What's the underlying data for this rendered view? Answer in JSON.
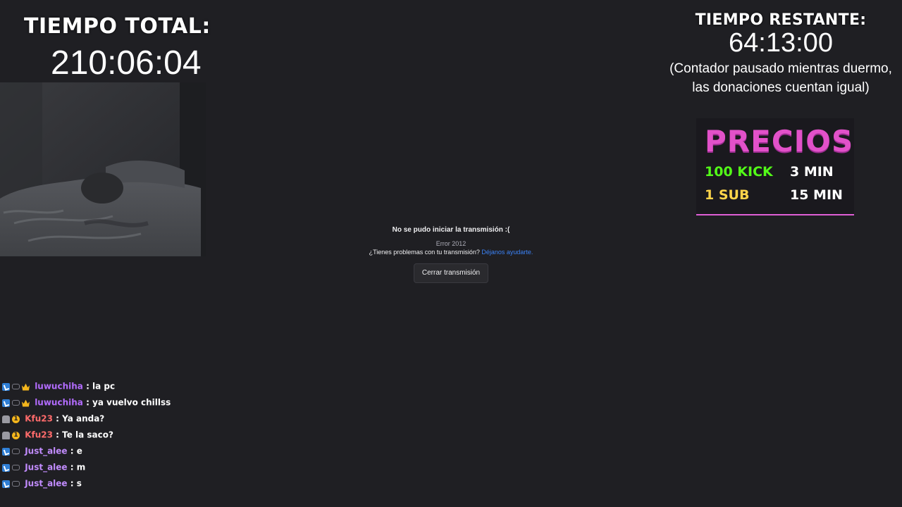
{
  "overlay": {
    "total_title": "TIEMPO TOTAL:",
    "total_time": "210:06:04",
    "remaining_title": "TIEMPO RESTANTE:",
    "remaining_time": "64:13:00",
    "remaining_note_line1": "(Contador pausado mientras duermo,",
    "remaining_note_line2": "las donaciones cuentan igual)"
  },
  "prices": {
    "title": "PRECIOS",
    "rows": [
      {
        "amount": "100 KICK",
        "time": "3 MIN",
        "color": "#53fc18"
      },
      {
        "amount": "1 SUB",
        "time": "15 MIN",
        "color": "#ffd54a"
      }
    ],
    "title_color": "#e251c9"
  },
  "error": {
    "title": "No se pudo iniciar la transmisión :(",
    "code": "Error 2012",
    "help_text": "¿Tienes problemas con tu transmisión?",
    "help_link": "Déjanos ayudarte.",
    "close_button": "Cerrar transmisión"
  },
  "chat": {
    "messages": [
      {
        "user": "luwuchiha",
        "text": "la pc",
        "user_color": "#b36cff",
        "badges": [
          "prime-icon",
          "link-icon",
          "crown-icon"
        ]
      },
      {
        "user": "luwuchiha",
        "text": "ya vuelvo chillss",
        "user_color": "#b36cff",
        "badges": [
          "prime-icon",
          "link-icon",
          "crown-icon"
        ]
      },
      {
        "user": "Kfu23",
        "text": "Ya anda?",
        "user_color": "#ff6b6b",
        "badges": [
          "bot-icon",
          "one-month-icon"
        ]
      },
      {
        "user": "Kfu23",
        "text": "Te la saco?",
        "user_color": "#ff6b6b",
        "badges": [
          "bot-icon",
          "one-month-icon"
        ]
      },
      {
        "user": "Just_alee",
        "text": "e",
        "user_color": "#c28cff",
        "badges": [
          "prime-icon",
          "link-icon"
        ]
      },
      {
        "user": "Just_alee",
        "text": "m",
        "user_color": "#c28cff",
        "badges": [
          "prime-icon",
          "link-icon"
        ]
      },
      {
        "user": "Just_alee",
        "text": "s",
        "user_color": "#c28cff",
        "badges": [
          "prime-icon",
          "link-icon"
        ]
      }
    ]
  }
}
